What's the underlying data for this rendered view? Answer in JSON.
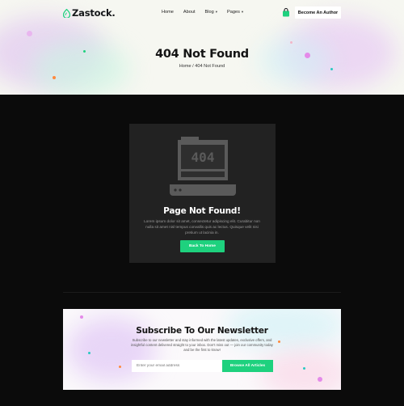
{
  "brand": {
    "name": "Zastock.",
    "accent": "#1ed17e"
  },
  "nav": {
    "items": [
      {
        "label": "Home",
        "has_dropdown": false
      },
      {
        "label": "About",
        "has_dropdown": false
      },
      {
        "label": "Blog",
        "has_dropdown": true
      },
      {
        "label": "Pages",
        "has_dropdown": true
      }
    ],
    "cta_label": "Become An Author",
    "cart_icon": "shopping-bag-icon"
  },
  "hero": {
    "title": "404 Not Found",
    "breadcrumb": "Home / 404 Not Found"
  },
  "error_card": {
    "illustration_code": "404",
    "illustration_icon": "laptop-404-icon",
    "title": "Page Not Found!",
    "description": "Lorem ipsum dolor sit amet, consectetur adipiscing elit. Curabitur non nulla sit amet nisl tempus convallis quis ac lectus. Quisque velit nisi pretium ut lacinia in.",
    "button_label": "Back To Home"
  },
  "newsletter": {
    "title": "Subscribe To Our Newsletter",
    "description": "Subscribe to our newsletter and stay informed with the latest updates, exclusive offers, and insightful content delivered straight to your inbox. Don't miss out — join our community today and be the first to know!",
    "email_placeholder": "Enter your email address",
    "button_label": "Browse All Articles"
  },
  "colors": {
    "page_bg": "#0b0b0b",
    "card_bg": "#222222",
    "hero_bg": "#f6f7f1",
    "button_green": "#1ed17e"
  }
}
